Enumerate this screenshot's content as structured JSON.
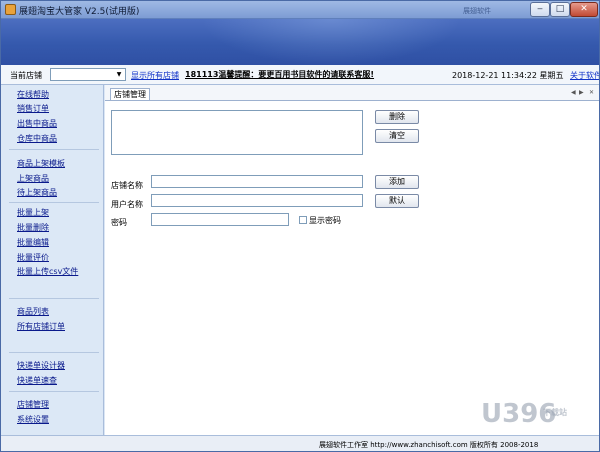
{
  "window": {
    "title": "展翅淘宝大管家 V2.5(试用版)",
    "title_ghost": "展翅软件",
    "minimize": "‒",
    "maximize": "□",
    "close": "✕"
  },
  "storebar": {
    "current_store_label": "当前店铺",
    "store_select_value": "",
    "show_all_link": "显示所有店铺",
    "notice": "181113温馨提醒：要更百用书目软件的请联系客服!",
    "datetime": "2018-12-21  11:34:22  星期五",
    "about_link": "关于软件"
  },
  "sidebar": {
    "items": [
      "在线帮助",
      "销售订单",
      "出售中商品",
      "仓库中商品",
      "商品上架模板",
      "上架商品",
      "待上架商品",
      "批量上架",
      "批量删除",
      "批量编辑",
      "批量评价",
      "批量上传csv文件",
      "商品列表",
      "所有店铺订单",
      "快递单设计器",
      "快递单速查",
      "店铺管理",
      "系统设置"
    ]
  },
  "content": {
    "tab_label": "店铺管理",
    "scroll_left": "◀",
    "scroll_right": "▶",
    "close_tab": "✕",
    "delete_button": "删除",
    "clear_button": "清空",
    "store_name_label": "店铺名称",
    "user_name_label": "用户名称",
    "password_label": "密码",
    "store_name_value": "",
    "user_name_value": "",
    "password_value": "",
    "add_button": "添加",
    "default_button": "默认",
    "show_password_label": "显示密码"
  },
  "statusbar": {
    "text": "展翅软件工作室 http://www.zhanchisoft.com 版权所有 2008-2018"
  },
  "watermark": {
    "text": "U396",
    "sub": "下载站"
  },
  "colors": {
    "banner": "#3559ad",
    "link": "#1032c8",
    "nav_link": "#0a1a8c"
  }
}
